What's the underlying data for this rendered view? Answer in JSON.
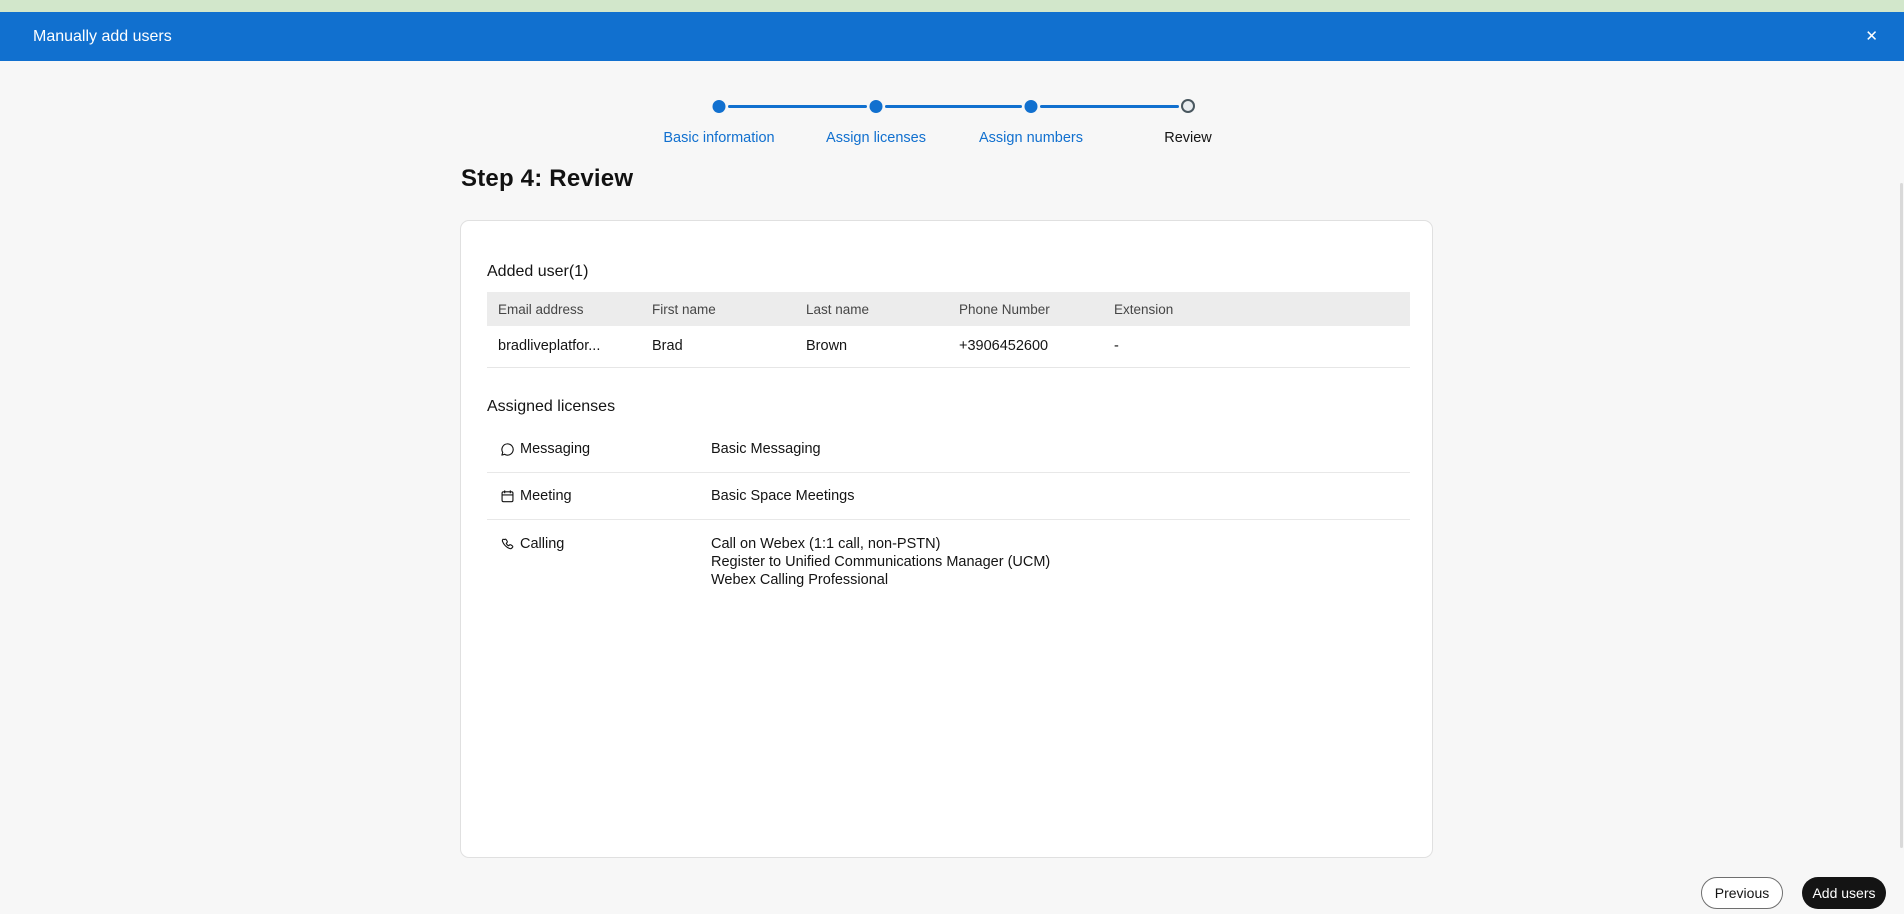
{
  "window": {
    "title": "Manually add users",
    "close_icon": "✕"
  },
  "stepper": {
    "steps": [
      {
        "label": "Basic information",
        "state": "complete"
      },
      {
        "label": "Assign licenses",
        "state": "complete"
      },
      {
        "label": "Assign numbers",
        "state": "complete"
      },
      {
        "label": "Review",
        "state": "current"
      }
    ]
  },
  "page": {
    "heading": "Step 4: Review"
  },
  "added_users": {
    "title": "Added user(1)",
    "columns": [
      "Email address",
      "First name",
      "Last name",
      "Phone Number",
      "Extension"
    ],
    "rows": [
      [
        "bradliveplatfor...",
        "Brad",
        "Brown",
        "+3906452600",
        "-"
      ]
    ]
  },
  "assigned_licenses": {
    "title": "Assigned licenses",
    "items": [
      {
        "icon": "chat-icon",
        "label": "Messaging",
        "values": [
          "Basic Messaging"
        ]
      },
      {
        "icon": "calendar-icon",
        "label": "Meeting",
        "values": [
          "Basic Space Meetings"
        ]
      },
      {
        "icon": "phone-icon",
        "label": "Calling",
        "values": [
          "Call on Webex (1:1 call, non-PSTN)",
          "Register to Unified Communications Manager (UCM)",
          "Webex Calling Professional"
        ]
      }
    ]
  },
  "footer": {
    "previous": "Previous",
    "add_users": "Add users"
  },
  "colors": {
    "accent": "#1170CF",
    "header_bg": "#1170CF",
    "top_strip": "#D2E7CB",
    "add_users_bg": "#141414",
    "table_header_bg": "#ECECEC"
  }
}
